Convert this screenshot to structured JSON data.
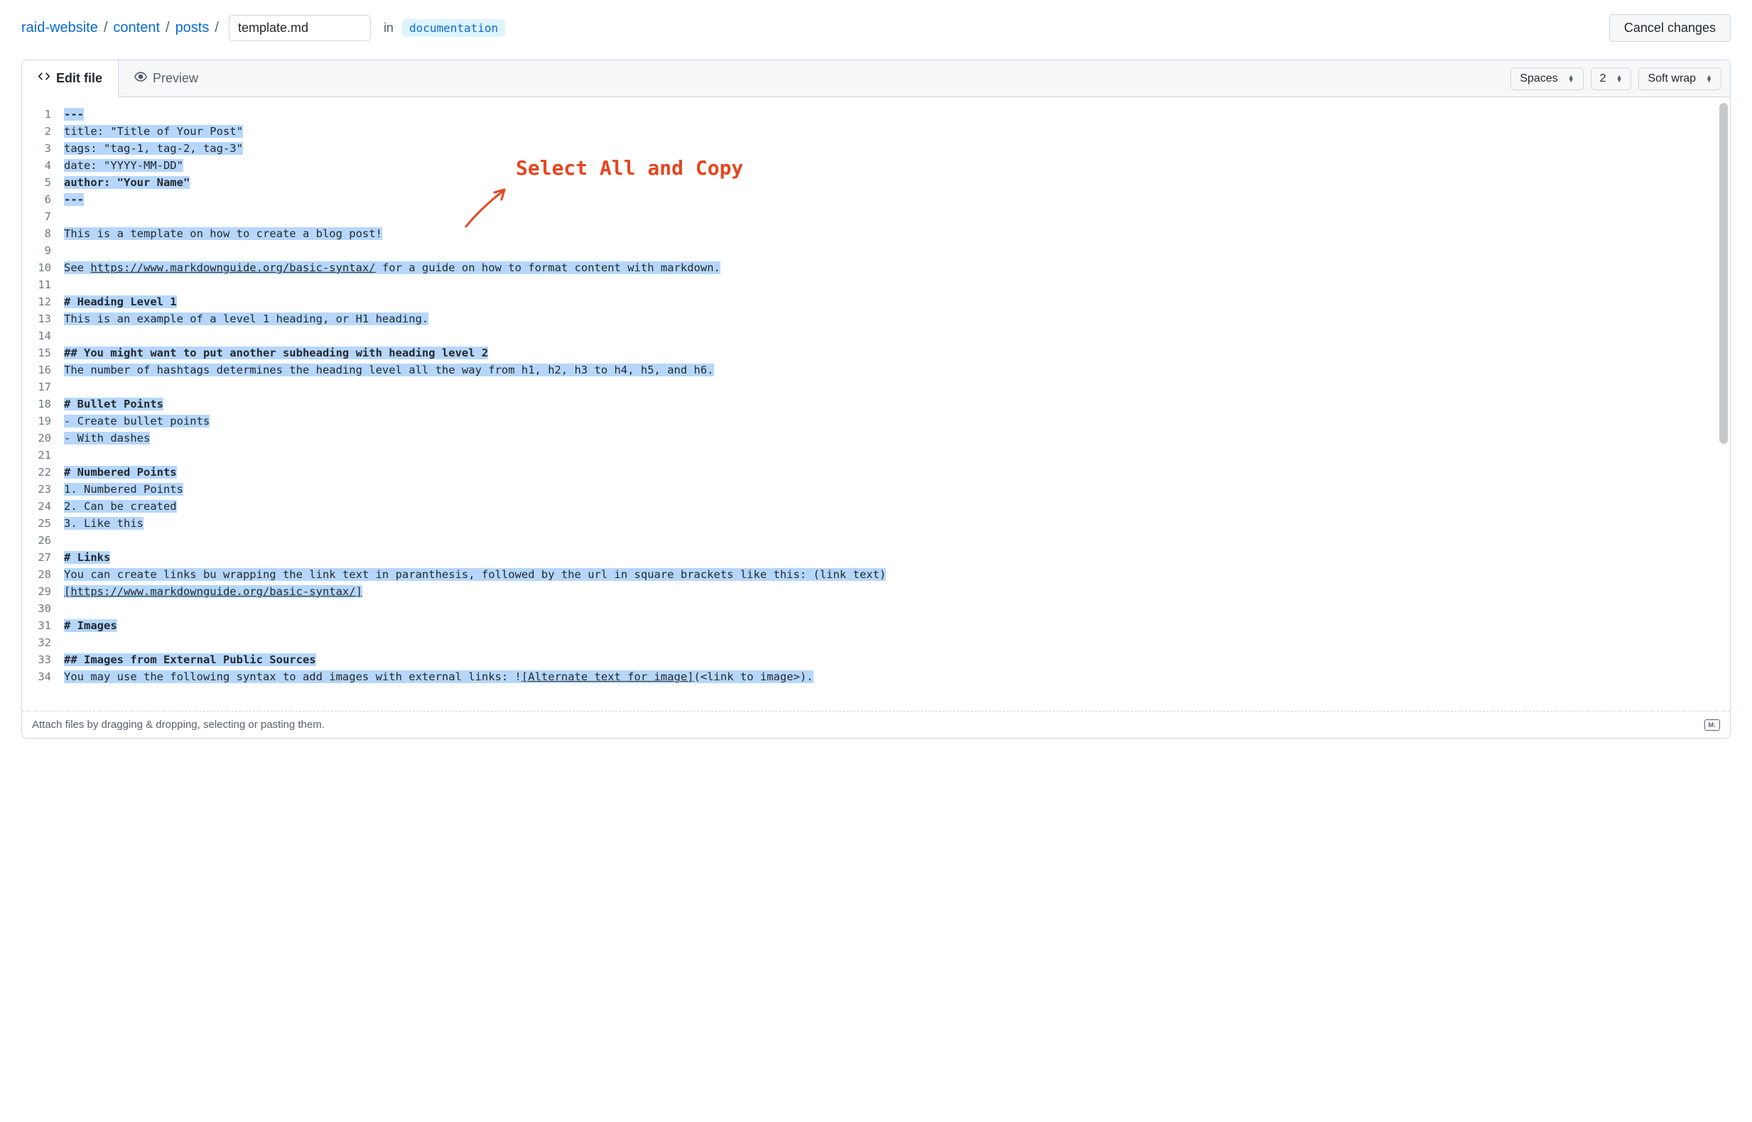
{
  "breadcrumb": {
    "parts": [
      "raid-website",
      "content",
      "posts"
    ],
    "sep": "/"
  },
  "filename": "template.md",
  "in_label": "in",
  "branch": "documentation",
  "cancel_label": "Cancel changes",
  "tabs": {
    "edit": "Edit file",
    "preview": "Preview"
  },
  "toolbar": {
    "indent_mode": "Spaces",
    "indent_size": "2",
    "wrap_mode": "Soft wrap"
  },
  "annotation": "Select All and Copy",
  "attach_hint": "Attach files by dragging & dropping, selecting or pasting them.",
  "md_icon_label": "M↓",
  "code": {
    "lines": [
      [
        {
          "t": "---",
          "b": true,
          "h": true
        }
      ],
      [
        {
          "t": "title: \"Title of Your Post\"",
          "h": true
        }
      ],
      [
        {
          "t": "tags: \"tag-1, tag-2, tag-3\"",
          "h": true
        }
      ],
      [
        {
          "t": "date: \"YYYY-MM-DD\"",
          "h": true
        }
      ],
      [
        {
          "t": "author: \"Your Name\"",
          "b": true,
          "h": true
        }
      ],
      [
        {
          "t": "---",
          "b": true,
          "h": true
        }
      ],
      [],
      [
        {
          "t": "This is a template on how to create a blog post!",
          "h": true
        }
      ],
      [],
      [
        {
          "t": "See ",
          "h": true
        },
        {
          "t": "https://www.markdownguide.org/basic-syntax/",
          "h": true,
          "u": true
        },
        {
          "t": " for a guide on how to format content with markdown.",
          "h": true
        }
      ],
      [],
      [
        {
          "t": "# Heading Level 1",
          "b": true,
          "h": true
        }
      ],
      [
        {
          "t": "This is an example of a level 1 heading, or H1 heading.",
          "h": true
        }
      ],
      [],
      [
        {
          "t": "## You might want to put another subheading with heading level 2",
          "b": true,
          "h": true
        }
      ],
      [
        {
          "t": "The number of hashtags determines the heading level all the way from h1, h2, h3 to h4, h5, and h6.",
          "h": true
        }
      ],
      [],
      [
        {
          "t": "# Bullet Points",
          "b": true,
          "h": true
        }
      ],
      [
        {
          "t": "- Create bullet points",
          "h": true
        }
      ],
      [
        {
          "t": "- With dashes",
          "h": true
        }
      ],
      [],
      [
        {
          "t": "# Numbered Points",
          "b": true,
          "h": true
        }
      ],
      [
        {
          "t": "1. Numbered Points",
          "h": true
        }
      ],
      [
        {
          "t": "2. Can be created",
          "h": true
        }
      ],
      [
        {
          "t": "3. Like this",
          "h": true
        }
      ],
      [],
      [
        {
          "t": "# Links",
          "b": true,
          "h": true
        }
      ],
      [
        {
          "t": "You can create links bu wrapping the link text in paranthesis, followed by the url in square brackets like this: (link text)",
          "h": true
        },
        {
          "br": true
        },
        {
          "t": "[https://www.markdownguide.org/basic-syntax/]",
          "h": true,
          "u": true
        }
      ],
      [],
      [
        {
          "t": "# Images",
          "b": true,
          "h": true
        }
      ],
      [],
      [
        {
          "t": "## Images from External Public Sources",
          "b": true,
          "h": true
        }
      ],
      [
        {
          "t": "You may use the following syntax to add images with external links: !",
          "h": true
        },
        {
          "t": "[Alternate text for image]",
          "h": true,
          "u": true
        },
        {
          "t": "(<link to image>).",
          "h": true
        }
      ],
      []
    ]
  }
}
